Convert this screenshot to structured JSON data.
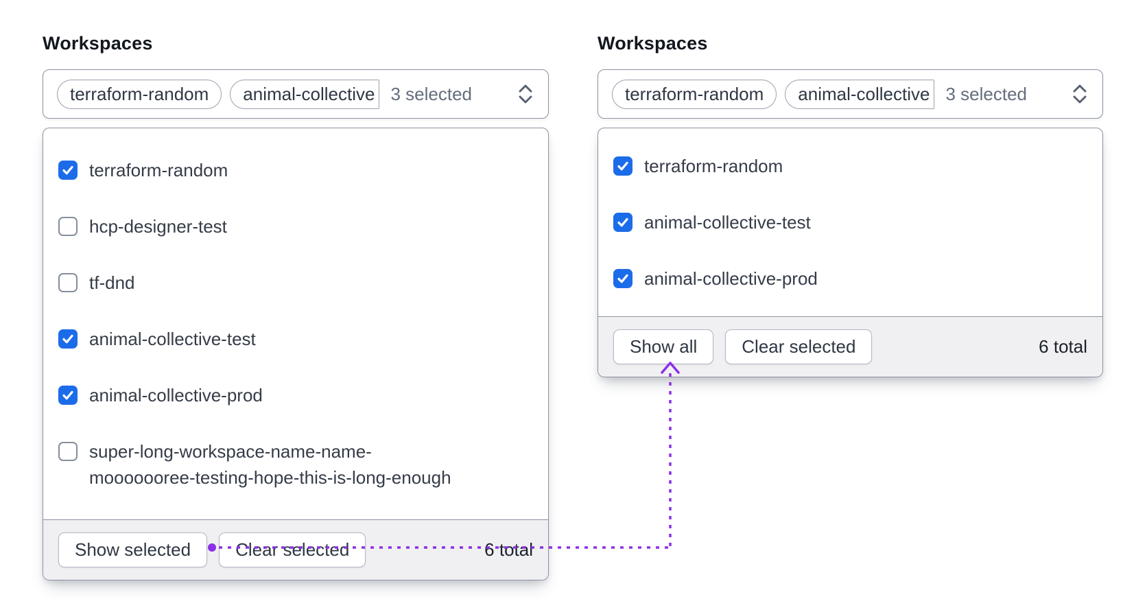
{
  "colors": {
    "checkbox_blue": "#1c6ce9",
    "annotation_purple": "#8b2fe8",
    "footer_bg": "#f0f0f2",
    "border_gray": "#8b92a0"
  },
  "left": {
    "title": "Workspaces",
    "trigger": {
      "tags": [
        "terraform-random",
        "animal-collective"
      ],
      "selected_text": "3 selected"
    },
    "options": [
      {
        "label": "terraform-random",
        "checked": true
      },
      {
        "label": "hcp-designer-test",
        "checked": false
      },
      {
        "label": "tf-dnd",
        "checked": false
      },
      {
        "label": "animal-collective-test",
        "checked": true
      },
      {
        "label": "animal-collective-prod",
        "checked": true
      },
      {
        "label": "super-long-workspace-name-name-mooooooree-testing-hope-this-is-long-enough",
        "checked": false
      }
    ],
    "footer": {
      "buttons": [
        "Show selected",
        "Clear selected"
      ],
      "total": "6 total"
    }
  },
  "right": {
    "title": "Workspaces",
    "trigger": {
      "tags": [
        "terraform-random",
        "animal-collective"
      ],
      "selected_text": "3 selected"
    },
    "options": [
      {
        "label": "terraform-random",
        "checked": true
      },
      {
        "label": "animal-collective-test",
        "checked": true
      },
      {
        "label": "animal-collective-prod",
        "checked": true
      }
    ],
    "footer": {
      "buttons": [
        "Show all",
        "Clear selected"
      ],
      "total": "6 total"
    }
  }
}
